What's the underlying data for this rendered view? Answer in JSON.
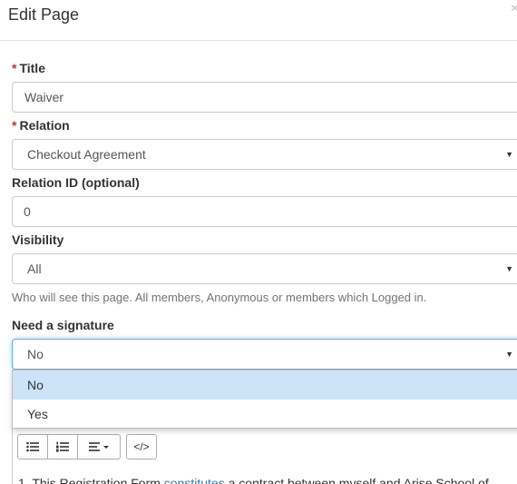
{
  "modal": {
    "title": "Edit Page",
    "close_glyph": "×"
  },
  "form": {
    "required_mark": "*",
    "title": {
      "label": "Title",
      "value": "Waiver"
    },
    "relation": {
      "label": "Relation",
      "value": "Checkout Agreement"
    },
    "relation_id": {
      "label": "Relation ID (optional)",
      "value": "0"
    },
    "visibility": {
      "label": "Visibility",
      "value": "All",
      "help": "Who will see this page. All members, Anonymous or members which Logged in."
    },
    "signature": {
      "label": "Need a signature",
      "value": "No",
      "options": [
        "No",
        "Yes"
      ]
    }
  },
  "editor": {
    "toolbar": {
      "unordered_list_icon": "list-ul-icon",
      "ordered_list_icon": "list-ol-icon",
      "align_icon": "align-left-icon",
      "code_label": "</>"
    },
    "content_start": "1. This Registration Form ",
    "content_link": "constitutes",
    "content_end": " a contract between myself and Arise School of"
  },
  "colors": {
    "required": "#c9302c",
    "focus_border": "#66afe9",
    "selected_option_bg": "#cde3f7",
    "help_text": "#737373"
  }
}
